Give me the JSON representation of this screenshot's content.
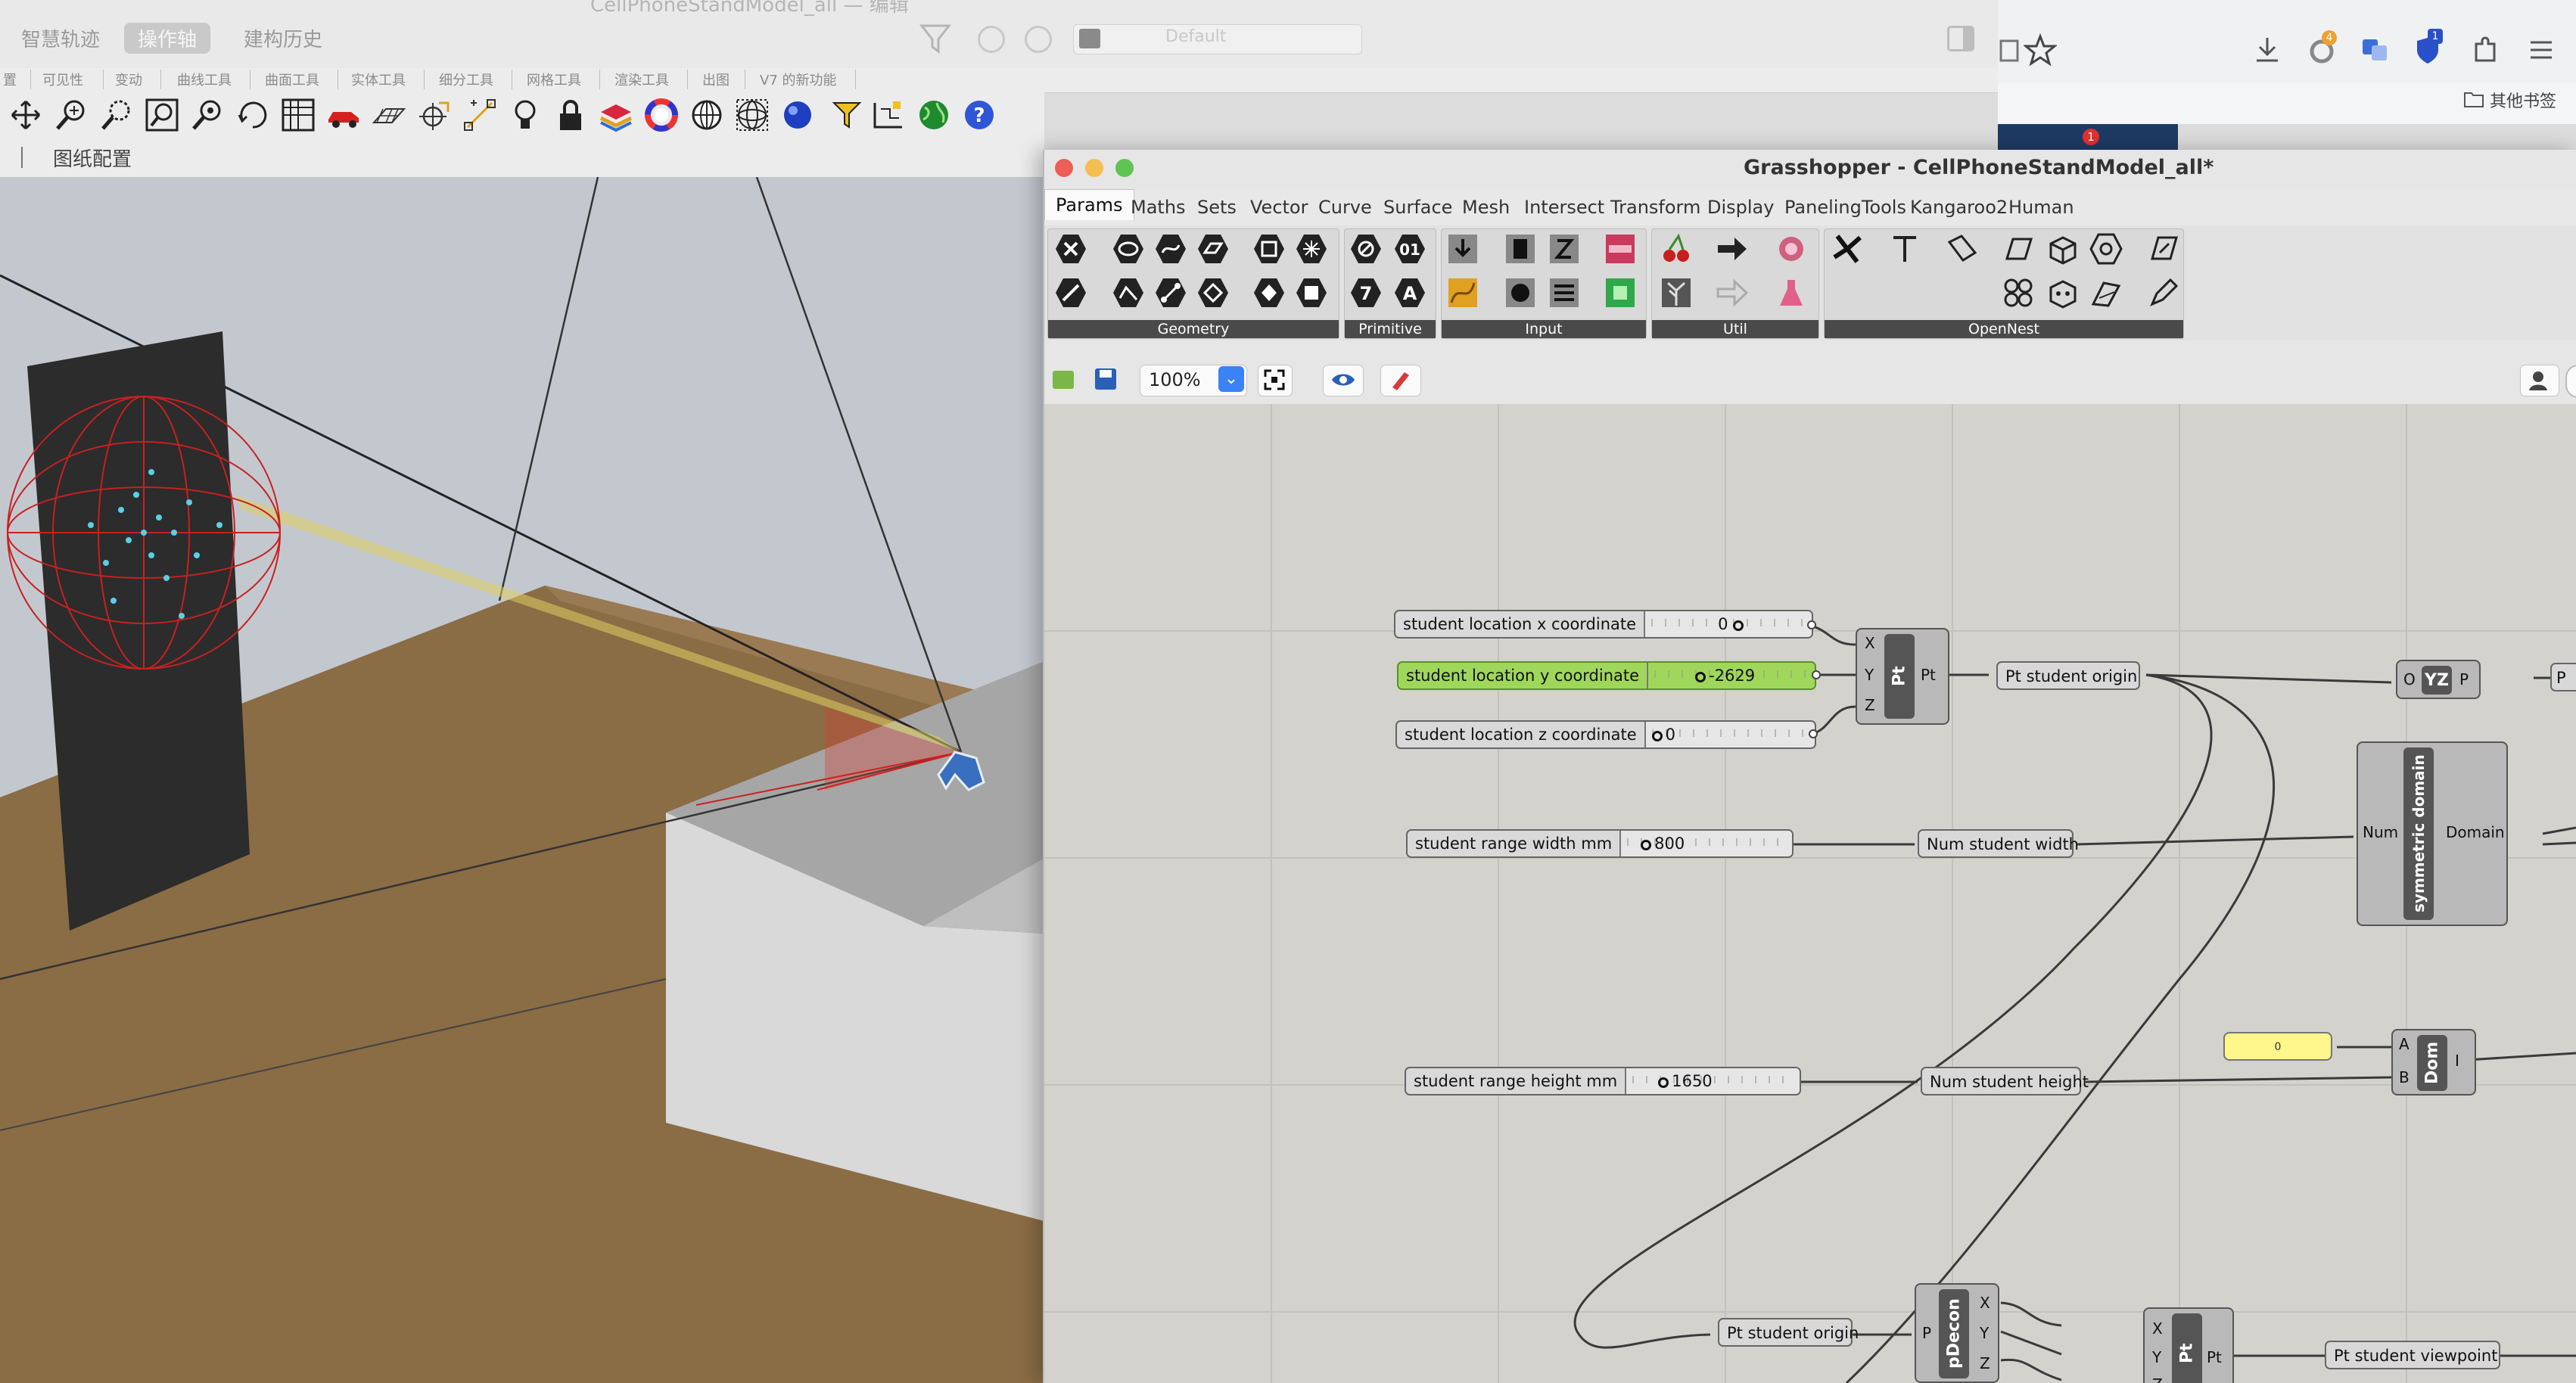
{
  "rhino": {
    "window_title": "CellPhoneStandModel_all",
    "title_suffix": "编辑",
    "tabs": [
      "智慧轨迹",
      "操作轴",
      "建构历史"
    ],
    "display_mode": "Default",
    "tabstrip": [
      "可见性",
      "变动",
      "曲线工具",
      "曲面工具",
      "实体工具",
      "细分工具",
      "网格工具",
      "渲染工具",
      "出图",
      "V7 的新功能"
    ],
    "layout_label": "图纸配置",
    "toolbar_icons": [
      "pan-icon",
      "zoom-in-icon",
      "zoom-window-icon",
      "zoom-extents-icon",
      "zoom-selected-icon",
      "rotate-view-icon",
      "four-viewports-icon",
      "car-icon",
      "grid-plane-icon",
      "cplane-icon",
      "osnap-icon",
      "light-icon",
      "lock-icon",
      "layer-icon",
      "color-wheel-icon",
      "sphere-render-icon",
      "wire-sphere-icon",
      "blue-sphere-icon",
      "tag-icon",
      "curve-tools-icon",
      "globe-icon",
      "help-icon"
    ]
  },
  "browser": {
    "bookmarks_label": "其他书签",
    "badge_a": "4",
    "badge_b": "1",
    "badge_c": "1"
  },
  "grasshopper": {
    "title": "Grasshopper - CellPhoneStandModel_all*",
    "tabs": [
      "Params",
      "Maths",
      "Sets",
      "Vector",
      "Curve",
      "Surface",
      "Mesh",
      "Intersect",
      "Transform",
      "Display",
      "PanelingTools",
      "Kangaroo2",
      "Human"
    ],
    "groups": [
      "Geometry",
      "Primitive",
      "Input",
      "Util",
      "OpenNest"
    ],
    "zoom": "100%",
    "components": {
      "slider_x": {
        "label": "student location x coordinate",
        "value": "0"
      },
      "slider_y": {
        "label": "student location y coordinate",
        "value": "-2629"
      },
      "slider_z": {
        "label": "student location z coordinate",
        "value": "0"
      },
      "slider_w": {
        "label": "student range width mm",
        "value": "800"
      },
      "slider_h": {
        "label": "student range height mm",
        "value": "1650"
      },
      "pt_node": {
        "name": "Pt",
        "in": [
          "X",
          "Y",
          "Z"
        ],
        "out": "Pt"
      },
      "pt_origin": "Pt student origin",
      "pt_origin2": "Pt student origin",
      "num_width": "Num student width",
      "num_height": "Num student height",
      "sym_domain": {
        "name": "symmetric domain",
        "in": "Num",
        "out": "Domain"
      },
      "yz_node": {
        "name": "YZ",
        "in": "O",
        "out": "P"
      },
      "dom_node": {
        "name": "Dom",
        "in": [
          "A",
          "B"
        ],
        "out": "I"
      },
      "yellow_panel": "0",
      "pdecon": {
        "name": "pDecon",
        "in": "P",
        "out": [
          "X",
          "Y",
          "Z"
        ]
      },
      "pt_node2": {
        "name": "Pt",
        "in": [
          "X",
          "Y",
          "Z"
        ],
        "out": "Pt"
      },
      "pt_viewpoint": "Pt student viewpoint",
      "edge_label": "P"
    }
  }
}
